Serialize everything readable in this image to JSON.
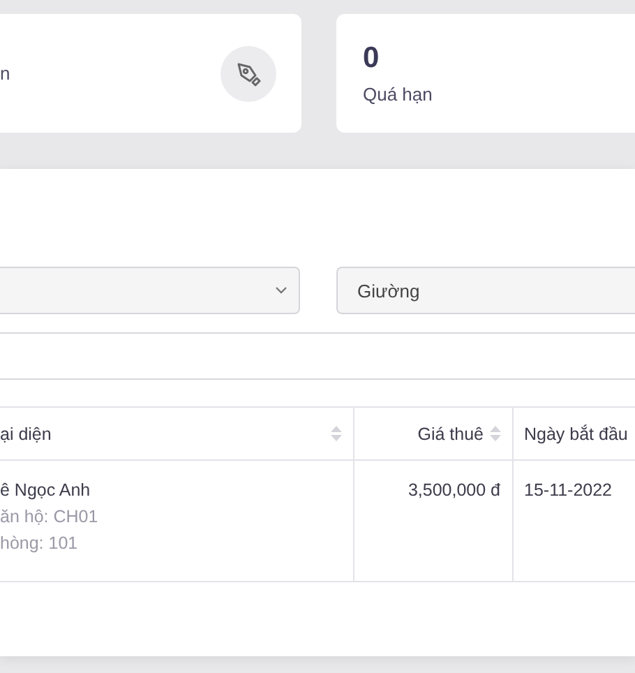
{
  "stat_cards": [
    {
      "label": "n"
    },
    {
      "value": "0",
      "label": "Quá hạn"
    }
  ],
  "filters": {
    "bed_field": {
      "value": "Giường"
    }
  },
  "table": {
    "columns": [
      {
        "label": "ại diện",
        "sortable": true
      },
      {
        "label": "Giá thuê",
        "sortable": true
      },
      {
        "label": "Ngày bắt đầu"
      }
    ],
    "rows": [
      {
        "tenant": "ê Ngọc Anh",
        "details": [
          "ăn hộ: CH01",
          "hòng: 101"
        ],
        "rent": "3,500,000 đ",
        "start_date": "15-11-2022"
      }
    ]
  }
}
